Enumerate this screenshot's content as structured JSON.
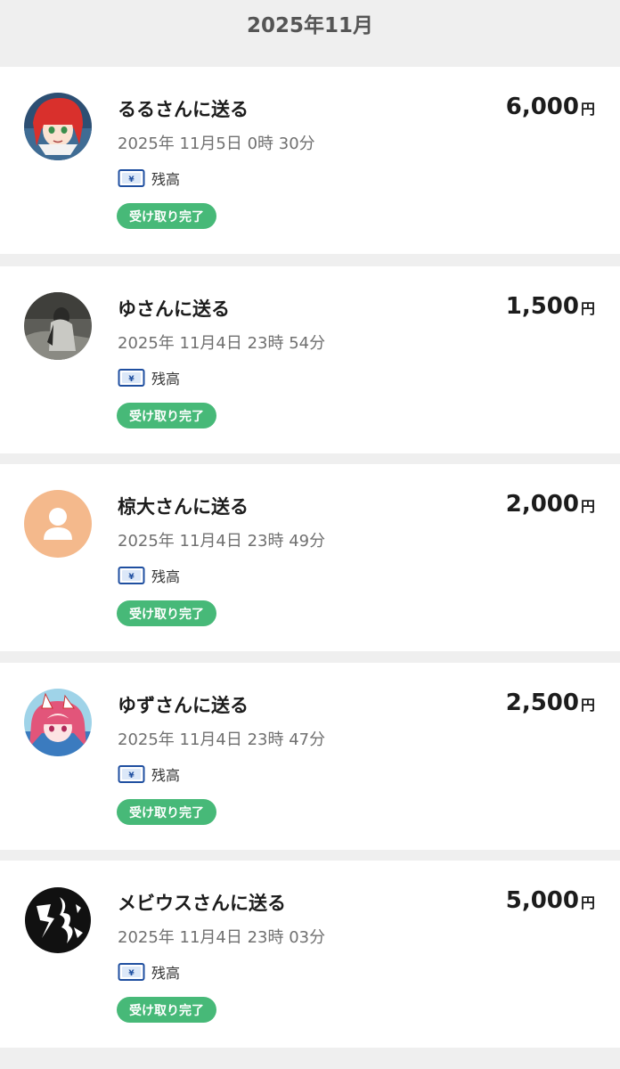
{
  "header": {
    "month": "2025年11月"
  },
  "transactions": [
    {
      "title": "るるさんに送る",
      "amount": "6,000",
      "currency": "円",
      "datetime": "2025年 11月5日  0時 30分",
      "method": "残高",
      "status": "受け取り完了",
      "avatar": "anime-red-hair-icon"
    },
    {
      "title": "ゆさんに送る",
      "amount": "1,500",
      "currency": "円",
      "datetime": "2025年 11月4日  23時 54分",
      "method": "残高",
      "status": "受け取り完了",
      "avatar": "photo-person-icon"
    },
    {
      "title": "椋大さんに送る",
      "amount": "2,000",
      "currency": "円",
      "datetime": "2025年 11月4日  23時 49分",
      "method": "残高",
      "status": "受け取り完了",
      "avatar": "default-user-icon"
    },
    {
      "title": "ゆずさんに送る",
      "amount": "2,500",
      "currency": "円",
      "datetime": "2025年 11月4日  23時 47分",
      "method": "残高",
      "status": "受け取り完了",
      "avatar": "anime-pink-fox-icon"
    },
    {
      "title": "メビウスさんに送る",
      "amount": "5,000",
      "currency": "円",
      "datetime": "2025年 11月4日  23時 03分",
      "method": "残高",
      "status": "受け取り完了",
      "avatar": "calligraphy-icon"
    }
  ],
  "colors": {
    "status_green": "#47b978",
    "background": "#efefef",
    "default_avatar": "#f4b98c",
    "balance_icon_blue": "#1f4fa0"
  }
}
